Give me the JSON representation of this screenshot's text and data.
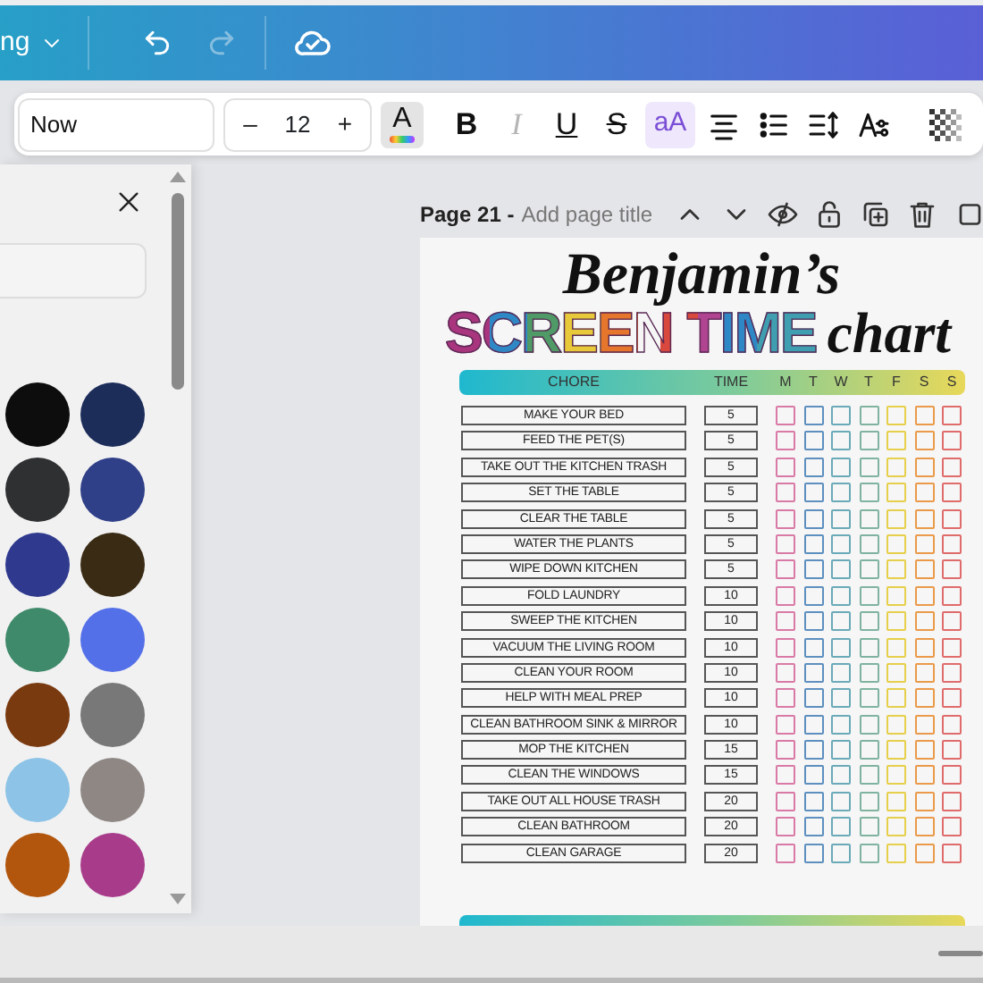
{
  "top_bar": {
    "menu_label": "ng",
    "redo": {
      "disabled": true
    }
  },
  "toolbar": {
    "font": "Now",
    "decrease": "–",
    "font_size": "12",
    "increase": "+",
    "tools": [
      {
        "kind": "text-color",
        "label": "A",
        "active": true
      },
      {
        "kind": "bold",
        "label": "B",
        "active": false,
        "disabled": false
      },
      {
        "kind": "italic",
        "label": "I",
        "active": false,
        "disabled": true
      },
      {
        "kind": "underline",
        "label": "U",
        "active": false,
        "disabled": false
      },
      {
        "kind": "strike",
        "label": "S",
        "active": false,
        "disabled": false
      },
      {
        "kind": "case",
        "label": "aA",
        "active": true,
        "disabled": false
      },
      {
        "kind": "align"
      },
      {
        "kind": "list"
      },
      {
        "kind": "spacing"
      },
      {
        "kind": "effects"
      },
      {
        "kind": "divider"
      },
      {
        "kind": "transparency"
      },
      {
        "kind": "divider"
      }
    ]
  },
  "color_panel": {
    "swatches": [
      {
        "color": "#0d0d0d"
      },
      {
        "color": "#1c2d5a"
      },
      {
        "color": "#2f3032"
      },
      {
        "color": "#2f3f88"
      },
      {
        "color": "#2f3a8e"
      },
      {
        "color": "#3a2b14"
      },
      {
        "color": "#3f8a6a"
      },
      {
        "color": "#5470e8"
      },
      {
        "color": "#7a3a10"
      },
      {
        "color": "#787878"
      },
      {
        "color": "#8cc3e6"
      },
      {
        "color": "#8f8784"
      },
      {
        "color": "#b2560d"
      },
      {
        "color": "#a83c8a"
      }
    ]
  },
  "page_header": {
    "page_label": "Page 21 -",
    "title_placeholder": "Add page title"
  },
  "document": {
    "name": "Benjamin’s",
    "title": "SCREEN TIME",
    "title_suffix": "chart",
    "columns": {
      "chore": "CHORE",
      "time": "TIME"
    },
    "days": [
      {
        "label": "M",
        "color": "#d97aa6"
      },
      {
        "label": "T",
        "color": "#5d8fbf"
      },
      {
        "label": "W",
        "color": "#6aaab8"
      },
      {
        "label": "T",
        "color": "#7fb3a0"
      },
      {
        "label": "F",
        "color": "#e6cf4a"
      },
      {
        "label": "S",
        "color": "#ea9a4a"
      },
      {
        "label": "S",
        "color": "#e06b6b"
      }
    ],
    "rows": [
      {
        "chore": "MAKE YOUR BED",
        "time": "5"
      },
      {
        "chore": "FEED THE PET(S)",
        "time": "5"
      },
      {
        "chore": "TAKE OUT THE KITCHEN TRASH",
        "time": "5"
      },
      {
        "chore": "SET THE TABLE",
        "time": "5"
      },
      {
        "chore": "CLEAR THE TABLE",
        "time": "5"
      },
      {
        "chore": "WATER THE PLANTS",
        "time": "5"
      },
      {
        "chore": "WIPE DOWN KITCHEN",
        "time": "5"
      },
      {
        "chore": "FOLD LAUNDRY",
        "time": "10"
      },
      {
        "chore": "SWEEP THE KITCHEN",
        "time": "10"
      },
      {
        "chore": "VACUUM THE LIVING ROOM",
        "time": "10"
      },
      {
        "chore": "CLEAN YOUR ROOM",
        "time": "10"
      },
      {
        "chore": "HELP WITH MEAL PREP",
        "time": "10"
      },
      {
        "chore": "CLEAN BATHROOM SINK & MIRROR",
        "time": "10"
      },
      {
        "chore": "MOP THE KITCHEN",
        "time": "15"
      },
      {
        "chore": "CLEAN THE WINDOWS",
        "time": "15"
      },
      {
        "chore": "TAKE OUT ALL HOUSE TRASH",
        "time": "20"
      },
      {
        "chore": "CLEAN BATHROOM",
        "time": "20"
      },
      {
        "chore": "CLEAN GARAGE",
        "time": "20"
      }
    ]
  }
}
